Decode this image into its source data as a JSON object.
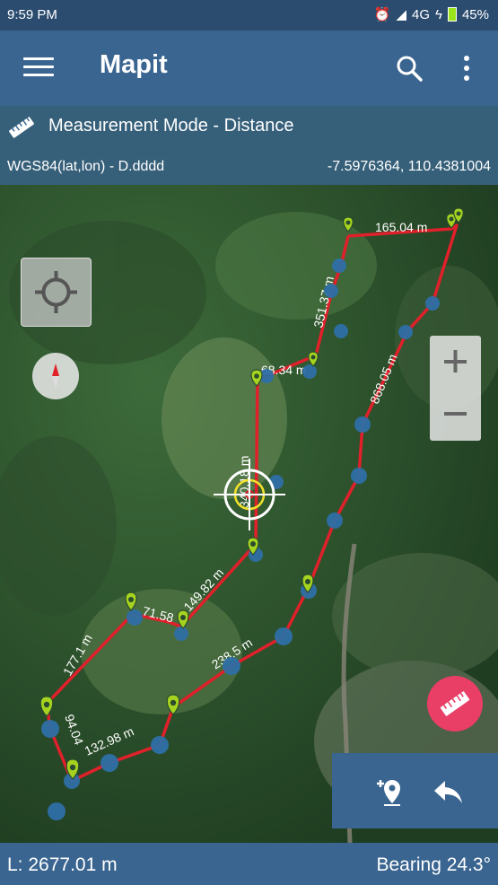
{
  "status_bar": {
    "time": "9:59 PM",
    "network": "4G",
    "battery": "45%"
  },
  "appbar": {
    "title": "Mapit"
  },
  "mode_bar": {
    "label": "Measurement Mode - Distance"
  },
  "coord_bar": {
    "format": "WGS84(lat,lon) - D.dddd",
    "coordinates": "-7.5976364, 110.4381004"
  },
  "segments": {
    "s1": "165.04 m",
    "s2": "351.37 m",
    "s3": "868.05 m",
    "s4": "68.34 m",
    "s5": "340.18 m",
    "s6": "149.82 m",
    "s7": "71.58",
    "s8": "177.1 m",
    "s9": "238.5 m",
    "s10": "132.98 m",
    "s11": "94.04"
  },
  "bottom_bar": {
    "length": "L: 2677.01 m",
    "bearing": "Bearing 24.3°"
  },
  "colors": {
    "appbar": "#3a6590",
    "status": "#2b4c6f",
    "path": "#e0202a",
    "marker": "#a6d41e",
    "node": "#2f6fa6",
    "fab": "#e93e65"
  },
  "icons": [
    "menu-icon",
    "search-icon",
    "more-vert-icon",
    "ruler-icon",
    "crosshair-icon",
    "compass-icon",
    "zoom-in-icon",
    "zoom-out-icon",
    "add-marker-icon",
    "undo-icon"
  ]
}
